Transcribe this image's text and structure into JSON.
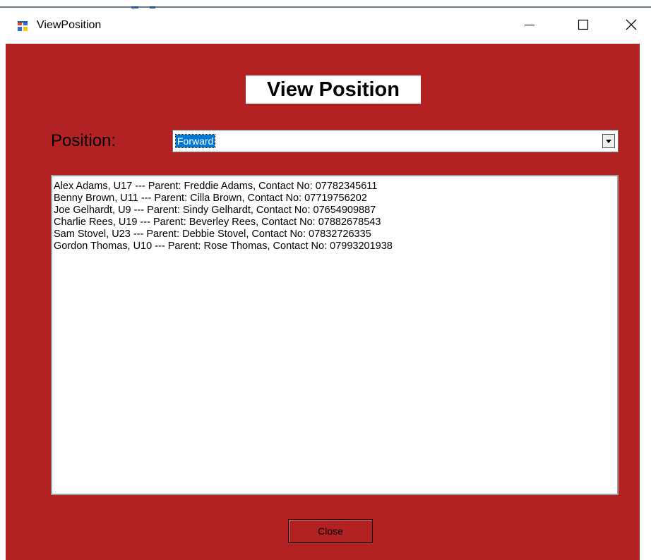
{
  "window": {
    "title": "ViewPosition",
    "icon": "windows-form-icon",
    "minimize_icon": "minimize-icon",
    "maximize_icon": "maximize-icon",
    "close_icon": "close-icon",
    "background_color": "#b22222"
  },
  "form": {
    "heading": "View Position",
    "position_label": "Position:",
    "position_selected": "Forward",
    "dropdown_icon": "chevron-down-icon",
    "list_items": [
      "Alex Adams, U17 --- Parent: Freddie Adams, Contact No: 07782345611",
      "Benny Brown, U11 --- Parent: Cilla Brown, Contact No: 07719756202",
      "Joe Gelhardt, U9 --- Parent: Sindy Gelhardt, Contact No: 07654909887",
      "Charlie Rees, U19 --- Parent: Beverley Rees, Contact No: 07882678543",
      "Sam Stovel, U23 --- Parent: Debbie Stovel, Contact No: 07832726335",
      "Gordon Thomas, U10 --- Parent: Rose Thomas, Contact No: 07993201938"
    ],
    "close_label": "Close"
  }
}
